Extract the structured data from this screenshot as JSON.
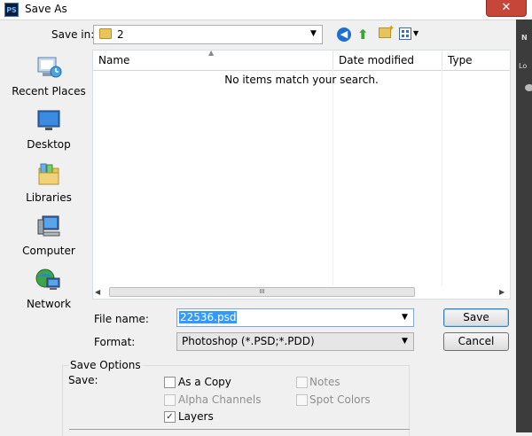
{
  "window": {
    "app_icon": "PS",
    "title": "Save As",
    "close_symbol": "✕"
  },
  "background_app": {
    "strip_label_1": "N",
    "strip_label_2": "Lo"
  },
  "toolbar": {
    "save_in_label": "Save in:",
    "save_in_value": "2",
    "dropdown_arrow": "▼",
    "icons": [
      "back-icon",
      "up-folder-icon",
      "new-folder-icon",
      "views-menu-icon"
    ]
  },
  "places": [
    {
      "label": "Recent Places",
      "icon": "recent-places-icon"
    },
    {
      "label": "Desktop",
      "icon": "desktop-icon"
    },
    {
      "label": "Libraries",
      "icon": "libraries-icon"
    },
    {
      "label": "Computer",
      "icon": "computer-icon"
    },
    {
      "label": "Network",
      "icon": "network-icon"
    }
  ],
  "file_list": {
    "columns": [
      "Name",
      "Date modified",
      "Type"
    ],
    "empty_message": "No items match your search.",
    "scroll_left": "◀",
    "scroll_right": "▶",
    "scroll_grip": "III"
  },
  "form": {
    "file_name_label": "File name:",
    "file_name_value": "22536.psd",
    "format_label": "Format:",
    "format_value": "Photoshop (*.PSD;*.PDD)"
  },
  "buttons": {
    "save": "Save",
    "cancel": "Cancel"
  },
  "save_options": {
    "title": "Save Options",
    "save_label": "Save:",
    "checkboxes": [
      {
        "label": "As a Copy",
        "checked": false,
        "enabled": true
      },
      {
        "label": "Notes",
        "checked": false,
        "enabled": false
      },
      {
        "label": "Alpha Channels",
        "checked": false,
        "enabled": false
      },
      {
        "label": "Spot Colors",
        "checked": false,
        "enabled": false
      },
      {
        "label": "Layers",
        "checked": true,
        "enabled": true
      }
    ],
    "check_mark": "✓"
  }
}
